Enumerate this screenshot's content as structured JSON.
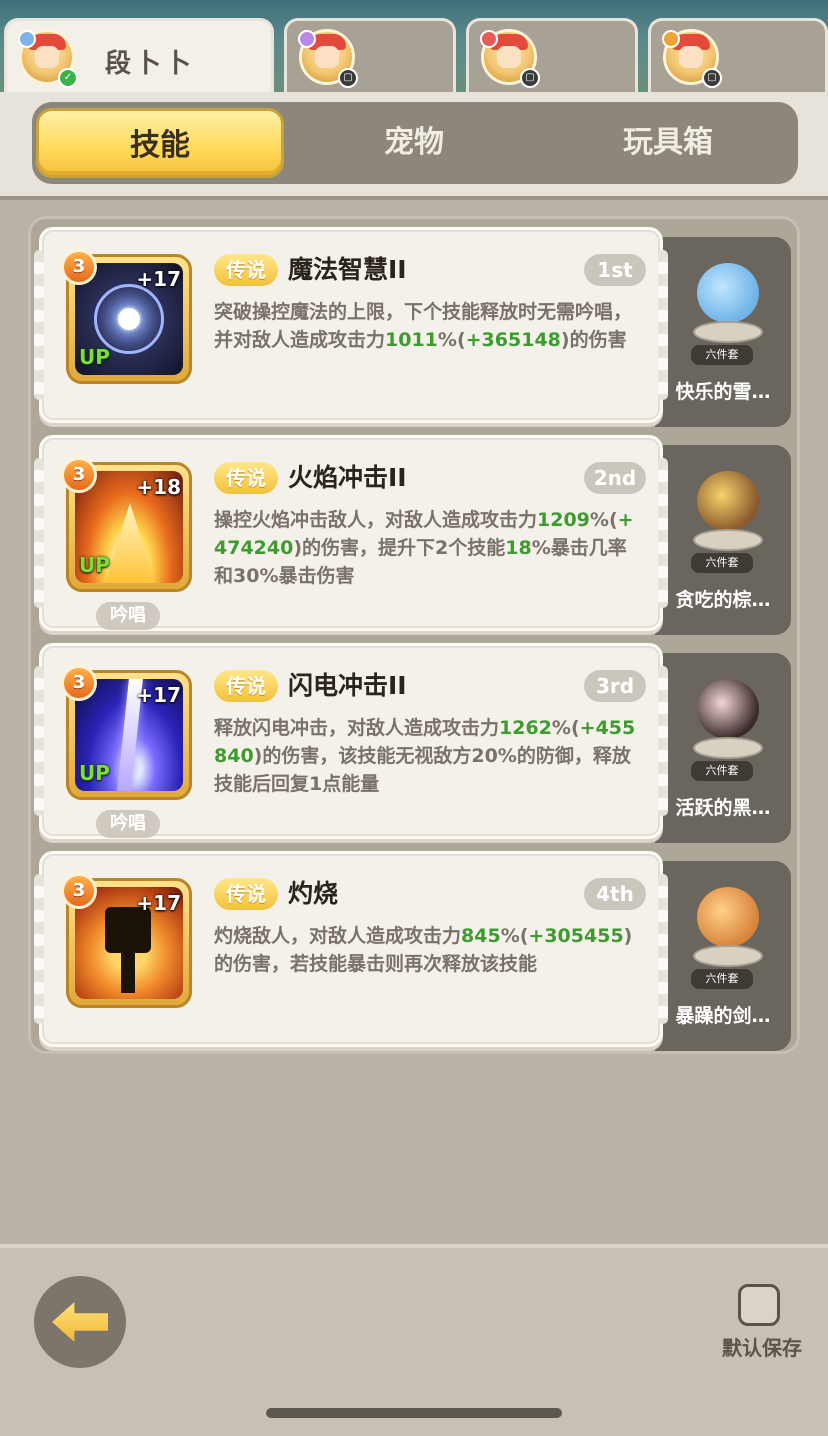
{
  "character_tabs": [
    {
      "name": "段卜卜",
      "active": true
    },
    {
      "name": "",
      "active": false
    },
    {
      "name": "",
      "active": false
    },
    {
      "name": "",
      "active": false
    }
  ],
  "tabs": [
    {
      "label": "技能",
      "active": true
    },
    {
      "label": "宠物",
      "active": false
    },
    {
      "label": "玩具箱",
      "active": false
    }
  ],
  "skills": [
    {
      "level": "3",
      "plus": "+17",
      "up": "UP",
      "rarity": "传说",
      "name": "魔法智慧II",
      "order": "1st",
      "desc_parts": [
        "突破操控魔法的上限，下个技能释放时无需吟唱，并对敌人造成攻击力",
        "1011",
        "%(",
        "+365148",
        ")的伤害"
      ],
      "chant": "",
      "pet_tag": "六件套",
      "pet_name": "快乐的雪…"
    },
    {
      "level": "3",
      "plus": "+18",
      "up": "UP",
      "rarity": "传说",
      "name": "火焰冲击II",
      "order": "2nd",
      "desc_parts": [
        "操控火焰冲击敌人，对敌人造成攻击力",
        "1209",
        "%(",
        "+474240",
        ")的伤害，提升下2个技能",
        "18",
        "%暴击几率和30%暴击伤害"
      ],
      "chant": "吟唱",
      "pet_tag": "六件套",
      "pet_name": "贪吃的棕…"
    },
    {
      "level": "3",
      "plus": "+17",
      "up": "UP",
      "rarity": "传说",
      "name": "闪电冲击II",
      "order": "3rd",
      "desc_parts": [
        "释放闪电冲击，对敌人造成攻击力",
        "1262",
        "%(",
        "+455840",
        ")的伤害，该技能无视敌方20%的防御，释放技能后回复1点能量"
      ],
      "chant": "吟唱",
      "pet_tag": "六件套",
      "pet_name": "活跃的黑…"
    },
    {
      "level": "3",
      "plus": "+17",
      "up": "",
      "rarity": "传说",
      "name": "灼烧",
      "order": "4th",
      "desc_parts": [
        "灼烧敌人，对敌人造成攻击力",
        "845",
        "%(",
        "+305455",
        ")的伤害，若技能暴击则再次释放该技能"
      ],
      "chant": "",
      "pet_tag": "六件套",
      "pet_name": "暴躁的剑…"
    }
  ],
  "bottom": {
    "save_label": "默认保存"
  },
  "colors": {
    "accent_yellow": "#ffd95a",
    "highlight_green": "#3d9b2f",
    "panel_gray": "#ada699"
  },
  "icons": [
    "back-arrow-icon",
    "checkbox-icon"
  ]
}
